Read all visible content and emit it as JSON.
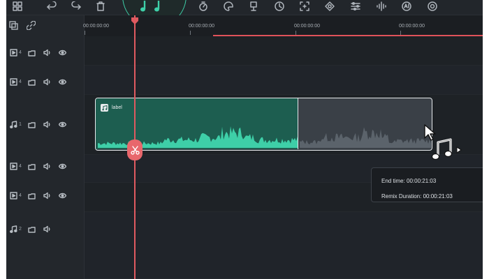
{
  "toolbar": {
    "icons": [
      "grid-icon",
      "undo-icon",
      "redo-icon",
      "delete-icon",
      "speed-icon",
      "color-icon",
      "keyframe-icon",
      "timer-icon",
      "crop-icon",
      "mask-icon",
      "adjust-icon",
      "audio-split-icon",
      "ai-icon",
      "render-icon"
    ]
  },
  "ruler": {
    "labels": [
      "00:00:00:00",
      "00:00:00:00",
      "00:00:00:00",
      "00:00:00:00"
    ]
  },
  "tracks": [
    {
      "type": "video",
      "index": "4"
    },
    {
      "type": "video",
      "index": "4"
    },
    {
      "type": "audio",
      "index": "1"
    },
    {
      "type": "video",
      "index": "4"
    },
    {
      "type": "video",
      "index": "4"
    },
    {
      "type": "audio",
      "index": "2"
    }
  ],
  "clip": {
    "label": "label"
  },
  "tooltip": {
    "end_time": "End time: 00:00:21:03",
    "remix_duration": "Remix Duration: 00:00:21:03"
  },
  "colors": {
    "accent": "#3ecfa8",
    "playhead": "#e05a60",
    "clip_active": "#1d5e50",
    "background": "#1b1e22"
  }
}
